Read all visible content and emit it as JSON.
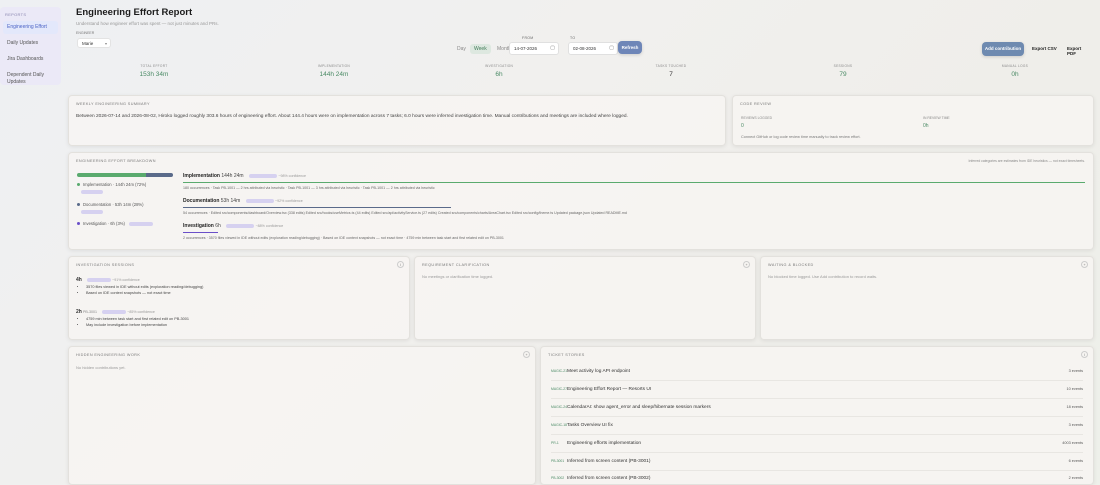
{
  "sidebar": {
    "heading": "REPORTS",
    "items": [
      {
        "label": "Engineering Effort",
        "active": true
      },
      {
        "label": "Daily Updates",
        "active": false
      },
      {
        "label": "Jira Dashboards",
        "active": false
      },
      {
        "label": "Dependent Daily Updates",
        "active": false
      }
    ]
  },
  "header": {
    "title": "Engineering Effort Report",
    "subtitle": "Understand how engineer effort was spent — not just minutes and PRs.",
    "person_label": "ENGINEER",
    "person_value": "Marie",
    "ranges": [
      "Day",
      "Week",
      "Month"
    ],
    "active_range": "Week",
    "from_label": "FROM",
    "to_label": "TO",
    "from_date": "14-07-2026",
    "to_date": "02-08-2026",
    "refresh_label": "Refresh",
    "add_contribution_label": "Add contribution",
    "export_csv_label": "Export CSV",
    "export_pdf_label": "Export PDF"
  },
  "stats": [
    {
      "label": "TOTAL EFFORT",
      "value": "153h 34m",
      "accent": true
    },
    {
      "label": "IMPLEMENTATION",
      "value": "144h 24m",
      "accent": true
    },
    {
      "label": "INVESTIGATION",
      "value": "6h",
      "accent": true
    },
    {
      "label": "TASKS TOUCHED",
      "value": "7",
      "accent": false
    },
    {
      "label": "SESSIONS",
      "value": "79",
      "accent": true
    },
    {
      "label": "MANUAL LOGS",
      "value": "0h",
      "accent": true
    }
  ],
  "weekly_summary": {
    "title": "WEEKLY ENGINEERING SUMMARY",
    "text": "Between 2026-07-14 and 2026-08-02, Hiroko logged roughly 303.6 hours of engineering effort. About 144.4 hours were on implementation across 7 tasks; 6.0 hours were inferred investigation time. Manual contributions and meetings are included where logged."
  },
  "code_review": {
    "title": "CODE REVIEW",
    "reviews_label": "REVIEWS LOGGED",
    "reviews_value": "0",
    "time_label": "IN REVIEW TIME",
    "time_value": "0h",
    "note": "Connect GitHub or log code review time manually to track review effort."
  },
  "breakdown": {
    "title": "ENGINEERING EFFORT BREAKDOWN",
    "note": "Inferred categories are estimates from IDE heuristics — not exact timesheets.",
    "colors": {
      "implementation": "#5aaa6e",
      "documentation": "#5a6a8a",
      "investigation": "#6a4fc8"
    },
    "shares": {
      "implementation": 0.72,
      "documentation": 0.28,
      "investigation": 0.03
    },
    "legend": [
      {
        "label": "Implementation · 144h 24m (72%)"
      },
      {
        "label": "Documentation · 53h 14m (28%)"
      },
      {
        "label": "Investigation · 6h (3%)"
      }
    ],
    "sections": [
      {
        "name": "Implementation",
        "hours": "144h 24m",
        "confidence": "~98% confidence",
        "detail": "180 occurrences · Task PB-1001 — 2 hrs attributed via heuristic · Task PB-1001 — 3 hrs attributed via heuristic · Task PB-1001 — 2 hrs attributed via heuristic"
      },
      {
        "name": "Documentation",
        "hours": "53h 14m",
        "confidence": "~92% confidence",
        "detail": "54 occurrences · Edited src/components/dashboard/Overview.tsx (338 edits) Edited src/hooks/useMetrics.ts (44 edits) Edited src/api/activityService.ts (27 edits) Created src/components/charts/AreaChart.tsx Edited src/config/theme.ts Updated package.json Updated README.md"
      },
      {
        "name": "Investigation",
        "hours": "6h",
        "confidence": "~88% confidence",
        "detail": "2 occurrences · 3570 files viewed in IDE without edits (exploration reading/debugging) · Based on IDE context snapshots — not exact time · 4759 min between task start and first related edit on PB-3001"
      }
    ]
  },
  "investigation_sessions": {
    "title": "INVESTIGATION SESSIONS",
    "sessions": [
      {
        "duration": "4h",
        "confidence": "~91% confidence",
        "bullets": [
          "3570 files viewed in IDE without edits (exploration reading/debugging)",
          "Based on IDE context snapshots — not exact time"
        ]
      },
      {
        "duration": "2h",
        "task": "PB-3001",
        "confidence": "~85% confidence",
        "bullets": [
          "4759 min between task start and first related edit on PB-3001",
          "May include investigation before implementation"
        ]
      }
    ]
  },
  "requirement_clarification": {
    "title": "REQUIREMENT CLARIFICATION",
    "empty": "No meetings or clarification time logged."
  },
  "waiting_blocked": {
    "title": "WAITING & BLOCKED",
    "empty": "No blocked time logged. Use Add contribution to record waits."
  },
  "hidden_work": {
    "title": "HIDDEN ENGINEERING WORK",
    "empty": "No hidden contributions yet."
  },
  "stories": {
    "title": "TICKET STORIES",
    "items": [
      {
        "key": "MAGIC-21",
        "title": "Meet activity log API endpoint",
        "events": "3 events"
      },
      {
        "key": "MAGIC-27",
        "title": "Engineering Effort Report — Resorts UI",
        "events": "10 events"
      },
      {
        "key": "MAGIC-24",
        "title": "CalendarAI: show agent_error and sleep/hibernate session markers",
        "events": "18 events"
      },
      {
        "key": "MAGIC-18",
        "title": "Tasks Overview UI fix",
        "events": "3 events"
      },
      {
        "key": "PR-1",
        "title": "Engineering efforts implementation",
        "events": "4003 events"
      },
      {
        "key": "PB-3001",
        "title": "Inferred from screen content (PB-3001)",
        "events": "6 events"
      },
      {
        "key": "PB-3002",
        "title": "Inferred from screen content (PB-3002)",
        "events": "2 events"
      }
    ]
  }
}
